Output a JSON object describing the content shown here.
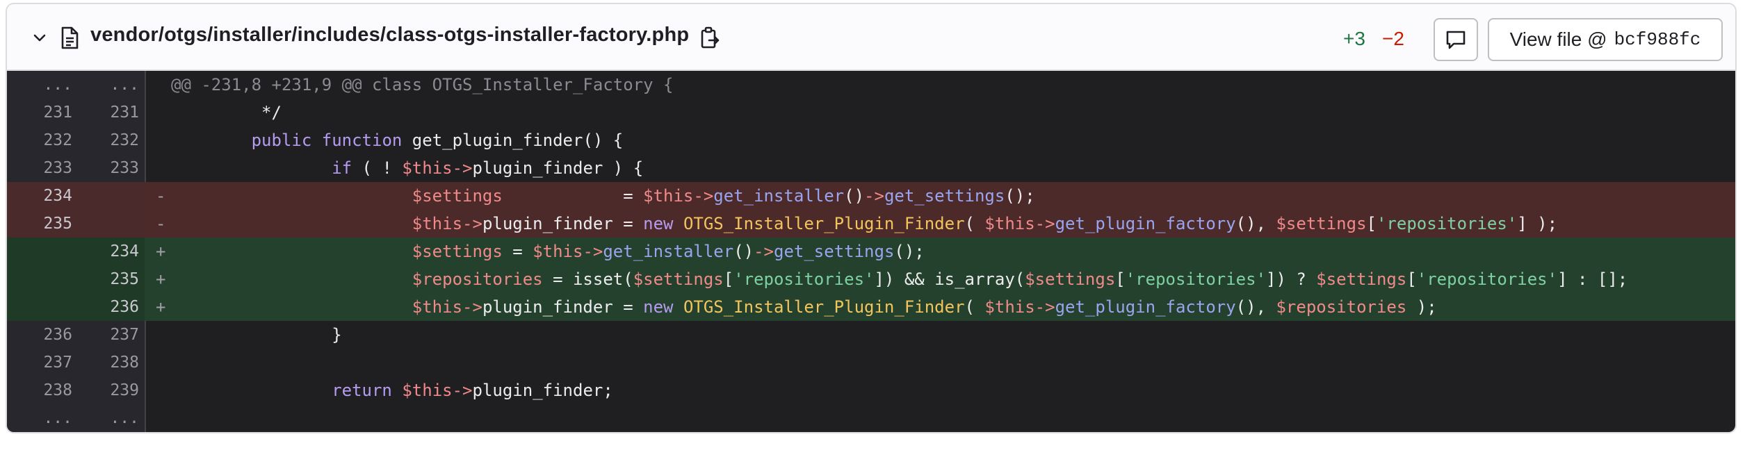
{
  "file": {
    "path": "vendor/otgs/installer/includes/class-otgs-installer-factory.php",
    "additions": "+3",
    "deletions": "−2",
    "view_file_label": "View file @",
    "view_file_sha": "bcf988fc"
  },
  "icons": {
    "collapse": "chevron-down-icon",
    "file": "file-icon",
    "copy": "copy-path-icon",
    "comment": "comment-icon"
  },
  "colors": {
    "addition": "#217645",
    "deletion": "#c91c00",
    "diff_background": "#1f1f21",
    "deleted_line_bg": "#4c2a2a",
    "added_line_bg": "#23412c"
  },
  "diff": {
    "hunk_header": "@@ -231,8 +231,9 @@ class OTGS_Installer_Factory {",
    "lines": [
      {
        "type": "hunk",
        "old": "...",
        "new": "...",
        "sign": "",
        "text": "@@ -231,8 +231,9 @@ class OTGS_Installer_Factory {"
      },
      {
        "type": "ctx",
        "old": "231",
        "new": "231",
        "sign": "",
        "text": "         */"
      },
      {
        "type": "ctx",
        "old": "232",
        "new": "232",
        "sign": "",
        "text": "        public function get_plugin_finder() {"
      },
      {
        "type": "ctx",
        "old": "233",
        "new": "233",
        "sign": "",
        "text": "                if ( ! $this->plugin_finder ) {"
      },
      {
        "type": "del",
        "old": "234",
        "new": "",
        "sign": "-",
        "text": "                        $settings            = $this->get_installer()->get_settings();"
      },
      {
        "type": "del",
        "old": "235",
        "new": "",
        "sign": "-",
        "text": "                        $this->plugin_finder = new OTGS_Installer_Plugin_Finder( $this->get_plugin_factory(), $settings['repositories'] );"
      },
      {
        "type": "add",
        "old": "",
        "new": "234",
        "sign": "+",
        "text": "                        $settings = $this->get_installer()->get_settings();"
      },
      {
        "type": "add",
        "old": "",
        "new": "235",
        "sign": "+",
        "text": "                        $repositories = isset($settings['repositories']) && is_array($settings['repositories']) ? $settings['repositories'] : [];"
      },
      {
        "type": "add",
        "old": "",
        "new": "236",
        "sign": "+",
        "text": "                        $this->plugin_finder = new OTGS_Installer_Plugin_Finder( $this->get_plugin_factory(), $repositories );"
      },
      {
        "type": "ctx",
        "old": "236",
        "new": "237",
        "sign": "",
        "text": "                }"
      },
      {
        "type": "ctx",
        "old": "237",
        "new": "238",
        "sign": "",
        "text": ""
      },
      {
        "type": "ctx",
        "old": "238",
        "new": "239",
        "sign": "",
        "text": "                return $this->plugin_finder;"
      },
      {
        "type": "more",
        "old": "...",
        "new": "...",
        "sign": "",
        "text": ""
      }
    ]
  }
}
